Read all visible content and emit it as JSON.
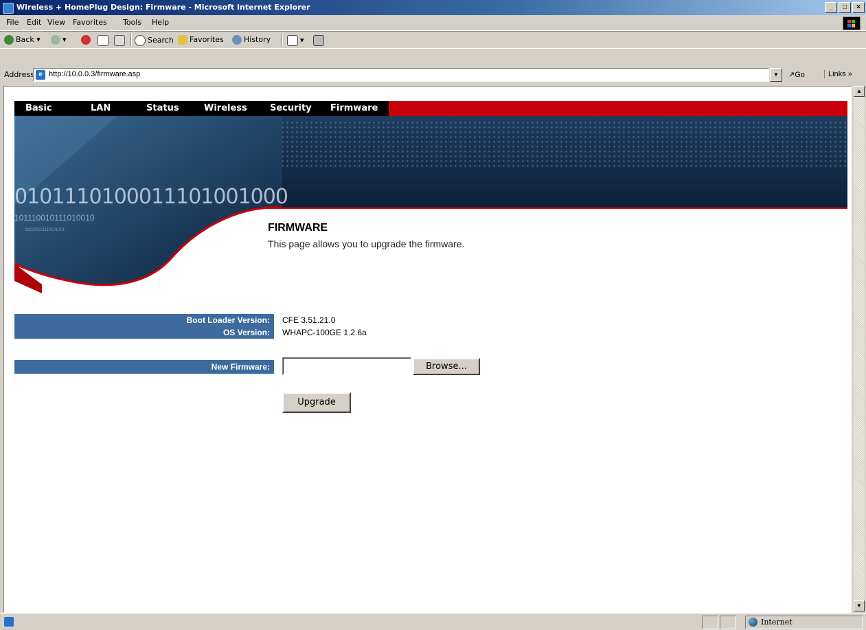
{
  "window": {
    "title": "Wireless + HomePlug Design: Firmware - Microsoft Internet Explorer",
    "minimize": "_",
    "maximize": "□",
    "close": "×"
  },
  "menu": [
    "File",
    "Edit",
    "View",
    "Favorites",
    "Tools",
    "Help"
  ],
  "toolbar": {
    "back": "Back",
    "search": "Search",
    "favorites": "Favorites",
    "history": "History"
  },
  "address": {
    "label": "Address",
    "url": "http://10.0.0.3/firmware.asp",
    "go": "Go",
    "links": "Links »"
  },
  "nav": [
    "Basic",
    "LAN",
    "Status",
    "Wireless",
    "Security",
    "Firmware"
  ],
  "banner": {
    "binary_large": "0101110100011101001000",
    "binary_small": "101110010111010010",
    "binary_tiny": "011100101110101001"
  },
  "page": {
    "heading": "FIRMWARE",
    "description": "This page allows you to upgrade the firmware."
  },
  "info": {
    "boot_loader_label": "Boot Loader Version:",
    "boot_loader_value": "CFE 3.51.21.0",
    "os_label": "OS Version:",
    "os_value": "WHAPC-100GE 1.2.6a"
  },
  "upgrade_form": {
    "new_firmware_label": "New Firmware:",
    "file_value": "",
    "browse_label": "Browse...",
    "upgrade_label": "Upgrade"
  },
  "statusbar": {
    "zone": "Internet"
  },
  "colors": {
    "nav_black": "#000000",
    "nav_red": "#c8000c",
    "label_blue": "#3d6b9e",
    "banner_navy": "#0c2038"
  }
}
